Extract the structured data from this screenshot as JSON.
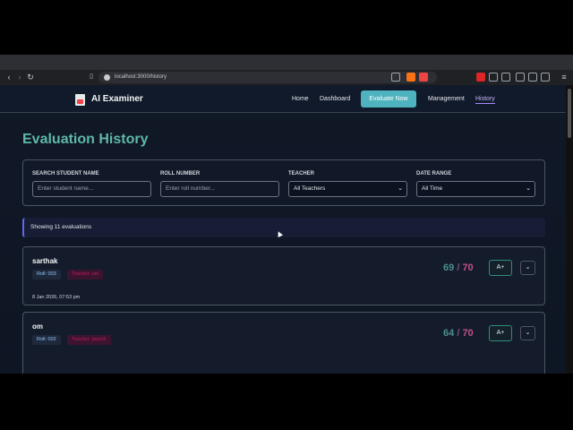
{
  "browser": {
    "url": "localhost:3000/history"
  },
  "header": {
    "brand": "AI Examiner",
    "nav": {
      "home": "Home",
      "dashboard": "Dashboard",
      "evaluate_now": "Evaluate Now",
      "management": "Management",
      "history": "History"
    }
  },
  "page": {
    "title": "Evaluation History"
  },
  "filters": {
    "student_name": {
      "label": "SEARCH STUDENT NAME",
      "placeholder": "Enter student name..."
    },
    "roll_number": {
      "label": "ROLL NUMBER",
      "placeholder": "Enter roll number..."
    },
    "teacher": {
      "label": "TEACHER",
      "value": "All Teachers"
    },
    "date_range": {
      "label": "DATE RANGE",
      "value": "All Time"
    }
  },
  "summary": {
    "showing": "Showing 11 evaluations"
  },
  "evaluations": [
    {
      "name": "sarthak",
      "roll": "Roll: 003",
      "teacher": "Teacher: om",
      "date": "8 Jan 2026, 07:53 pm",
      "score": "69",
      "sep": "/",
      "max": "70",
      "grade": "A+"
    },
    {
      "name": "om",
      "roll": "Roll: 002",
      "teacher": "Teacher: jayesh",
      "score": "64",
      "sep": "/",
      "max": "70",
      "grade": "A+"
    }
  ],
  "icons": {
    "back": "arrow-left-icon",
    "forward": "arrow-right-icon",
    "reload": "reload-icon",
    "expand": "chevron-down-icon"
  },
  "colors": {
    "accent_teal": "#4fb3bf",
    "title": "#5eb8a8",
    "score_max": "#c0508a"
  }
}
